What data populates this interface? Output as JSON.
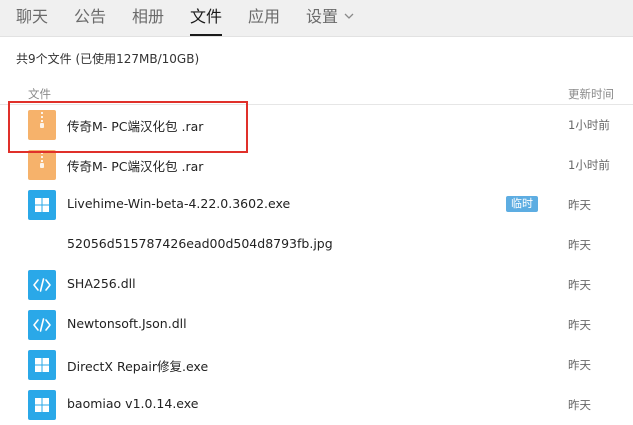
{
  "tabs": [
    {
      "label": "聊天"
    },
    {
      "label": "公告"
    },
    {
      "label": "相册"
    },
    {
      "label": "文件"
    },
    {
      "label": "应用"
    },
    {
      "label": "设置"
    }
  ],
  "active_tab": "文件",
  "summary": "共9个文件 (已使用127MB/10GB)",
  "columns": {
    "file": "文件",
    "time": "更新时间"
  },
  "files": [
    {
      "name": "传奇M- PC端汉化包 .rar",
      "time": "1小时前",
      "icon": "archive-icon"
    },
    {
      "name": "传奇M- PC端汉化包 .rar",
      "time": "1小时前",
      "icon": "archive-icon"
    },
    {
      "name": "Livehime-Win-beta-4.22.0.3602.exe",
      "time": "昨天",
      "icon": "windows-exe-icon",
      "badge": "临时"
    },
    {
      "name": "52056d515787426ead00d504d8793fb.jpg",
      "time": "昨天",
      "icon": "image-icon"
    },
    {
      "name": "SHA256.dll",
      "time": "昨天",
      "icon": "code-file-icon"
    },
    {
      "name": "Newtonsoft.Json.dll",
      "time": "昨天",
      "icon": "code-file-icon"
    },
    {
      "name": "DirectX Repair修复.exe",
      "time": "昨天",
      "icon": "windows-exe-icon"
    },
    {
      "name": "baomiao  v1.0.14.exe",
      "time": "昨天",
      "icon": "windows-exe-icon"
    }
  ],
  "colors": {
    "archive": "#f6b26b",
    "exe": "#2aa8e8",
    "highlight": "#e0302a",
    "badge": "#5dade2"
  }
}
